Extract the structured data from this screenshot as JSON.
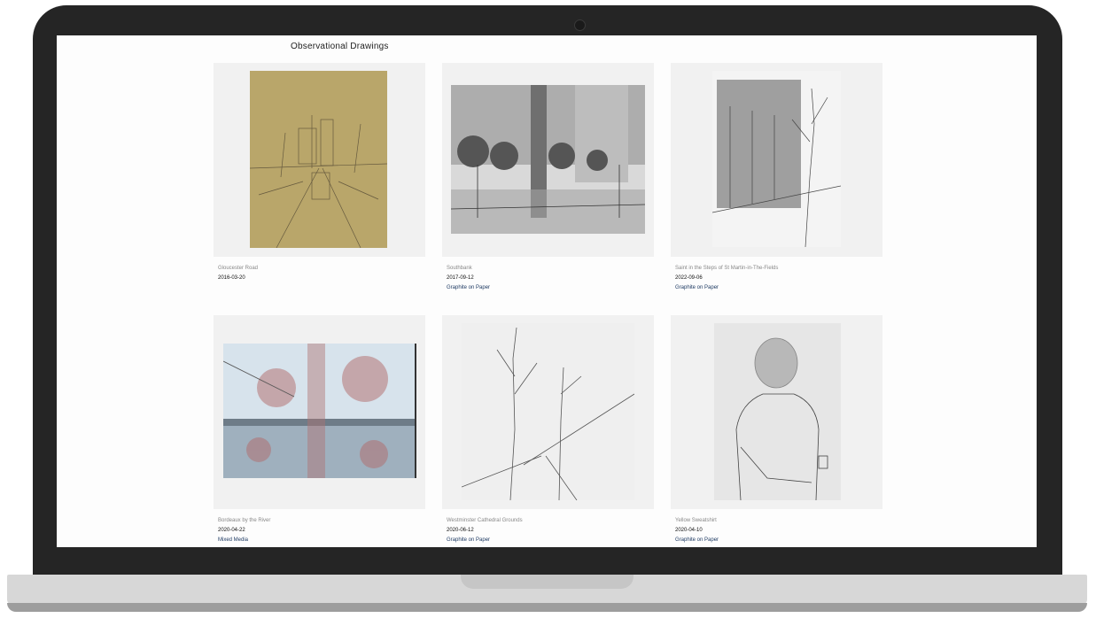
{
  "page": {
    "title": "Observational Drawings"
  },
  "artworks": [
    {
      "title": "Gloucester Road",
      "date": "2016-03-20",
      "medium": ""
    },
    {
      "title": "Southbank",
      "date": "2017-09-12",
      "medium": "Graphite on Paper"
    },
    {
      "title": "Saint in the Steps of St Martin-in-The-Fields",
      "date": "2022-09-06",
      "medium": "Graphite on Paper"
    },
    {
      "title": "Bordeaux by the River",
      "date": "2020-04-22",
      "medium": "Mixed Media"
    },
    {
      "title": "Westminster Cathedral Grounds",
      "date": "2020-06-12",
      "medium": "Graphite on Paper"
    },
    {
      "title": "Yellow Sweatshirt",
      "date": "2020-04-10",
      "medium": "Graphite on Paper"
    }
  ]
}
